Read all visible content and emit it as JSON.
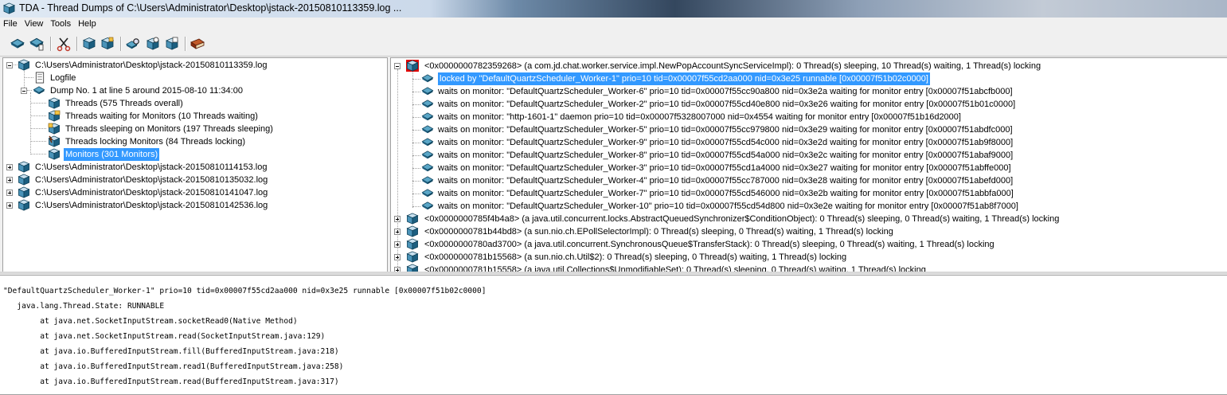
{
  "window": {
    "title": "TDA - Thread Dumps of C:\\Users\\Administrator\\Desktop\\jstack-20150810113359.log ..."
  },
  "menu": [
    "File",
    "View",
    "Tools",
    "Help"
  ],
  "toolbar": {
    "buttons": [
      "open-icon",
      "open-logfile-icon",
      "cut-icon",
      "dump-icon",
      "monitor-icon",
      "find-icon",
      "settings-icon",
      "filter-icon",
      "book-icon"
    ]
  },
  "left_tree": {
    "root1": "C:\\Users\\Administrator\\Desktop\\jstack-20150810113359.log",
    "logfile": "Logfile",
    "dump": "Dump No. 1 at line 5 around 2015-08-10 11:34:00",
    "items": [
      "Threads (575 Threads overall)",
      "Threads waiting for Monitors (10 Threads waiting)",
      "Threads sleeping on Monitors (197 Threads sleeping)",
      "Threads locking Monitors (84 Threads locking)",
      "Monitors (301 Monitors)"
    ],
    "other_logs": [
      "C:\\Users\\Administrator\\Desktop\\jstack-20150810114153.log",
      "C:\\Users\\Administrator\\Desktop\\jstack-20150810135032.log",
      "C:\\Users\\Administrator\\Desktop\\jstack-20150810141047.log",
      "C:\\Users\\Administrator\\Desktop\\jstack-20150810142536.log"
    ]
  },
  "right_tree": {
    "monitor": "<0x0000000782359268> (a com.jd.chat.worker.service.impl.NewPopAccountSyncServiceImpl):    0 Thread(s) sleeping, 10 Thread(s) waiting, 1 Thread(s) locking",
    "locked": "locked by \"DefaultQuartzScheduler_Worker-1\" prio=10 tid=0x00007f55cd2aa000 nid=0x3e25 runnable [0x00007f51b02c0000]",
    "waits": [
      "waits on monitor: \"DefaultQuartzScheduler_Worker-6\" prio=10 tid=0x00007f55cc90a800 nid=0x3e2a waiting for monitor entry [0x00007f51abcfb000]",
      "waits on monitor: \"DefaultQuartzScheduler_Worker-2\" prio=10 tid=0x00007f55cd40e800 nid=0x3e26 waiting for monitor entry [0x00007f51b01c0000]",
      "waits on monitor: \"http-1601-1\" daemon prio=10 tid=0x00007f5328007000 nid=0x4554 waiting for monitor entry [0x00007f51b16d2000]",
      "waits on monitor: \"DefaultQuartzScheduler_Worker-5\" prio=10 tid=0x00007f55cc979800 nid=0x3e29 waiting for monitor entry [0x00007f51abdfc000]",
      "waits on monitor: \"DefaultQuartzScheduler_Worker-9\" prio=10 tid=0x00007f55cd54c000 nid=0x3e2d waiting for monitor entry [0x00007f51ab9f8000]",
      "waits on monitor: \"DefaultQuartzScheduler_Worker-8\" prio=10 tid=0x00007f55cd54a000 nid=0x3e2c waiting for monitor entry [0x00007f51abaf9000]",
      "waits on monitor: \"DefaultQuartzScheduler_Worker-3\" prio=10 tid=0x00007f55cd1a4000 nid=0x3e27 waiting for monitor entry [0x00007f51abffe000]",
      "waits on monitor: \"DefaultQuartzScheduler_Worker-4\" prio=10 tid=0x00007f55cc787000 nid=0x3e28 waiting for monitor entry [0x00007f51abefd000]",
      "waits on monitor: \"DefaultQuartzScheduler_Worker-7\" prio=10 tid=0x00007f55cd546000 nid=0x3e2b waiting for monitor entry [0x00007f51abbfa000]",
      "waits on monitor: \"DefaultQuartzScheduler_Worker-10\" prio=10 tid=0x00007f55cd54d800 nid=0x3e2e waiting for monitor entry [0x00007f51ab8f7000]"
    ],
    "others": [
      "<0x0000000785f4b4a8> (a java.util.concurrent.locks.AbstractQueuedSynchronizer$ConditionObject):    0 Thread(s) sleeping, 0 Thread(s) waiting, 1 Thread(s) locking",
      "<0x0000000781b44bd8> (a sun.nio.ch.EPollSelectorImpl):    0 Thread(s) sleeping, 0 Thread(s) waiting, 1 Thread(s) locking",
      "<0x0000000780ad3700> (a java.util.concurrent.SynchronousQueue$TransferStack):    0 Thread(s) sleeping, 0 Thread(s) waiting, 1 Thread(s) locking",
      "<0x0000000781b15568> (a sun.nio.ch.Util$2):    0 Thread(s) sleeping, 0 Thread(s) waiting, 1 Thread(s) locking",
      "<0x0000000781b15558> (a java.util.Collections$UnmodifiableSet):    0 Thread(s) sleeping, 0 Thread(s) waiting, 1 Thread(s) locking"
    ]
  },
  "detail": {
    "lines": [
      "\"DefaultQuartzScheduler_Worker-1\" prio=10 tid=0x00007f55cd2aa000 nid=0x3e25 runnable [0x00007f51b02c0000]",
      "   java.lang.Thread.State: RUNNABLE",
      "        at java.net.SocketInputStream.socketRead0(Native Method)",
      "        at java.net.SocketInputStream.read(SocketInputStream.java:129)",
      "        at java.io.BufferedInputStream.fill(BufferedInputStream.java:218)",
      "        at java.io.BufferedInputStream.read1(BufferedInputStream.java:258)",
      "        at java.io.BufferedInputStream.read(BufferedInputStream.java:317)"
    ]
  },
  "colors": {
    "selection": "#3399ff",
    "cube_top": "#b7d3e6",
    "cube_side": "#1f6e8c",
    "lock_red": "#e00000"
  }
}
